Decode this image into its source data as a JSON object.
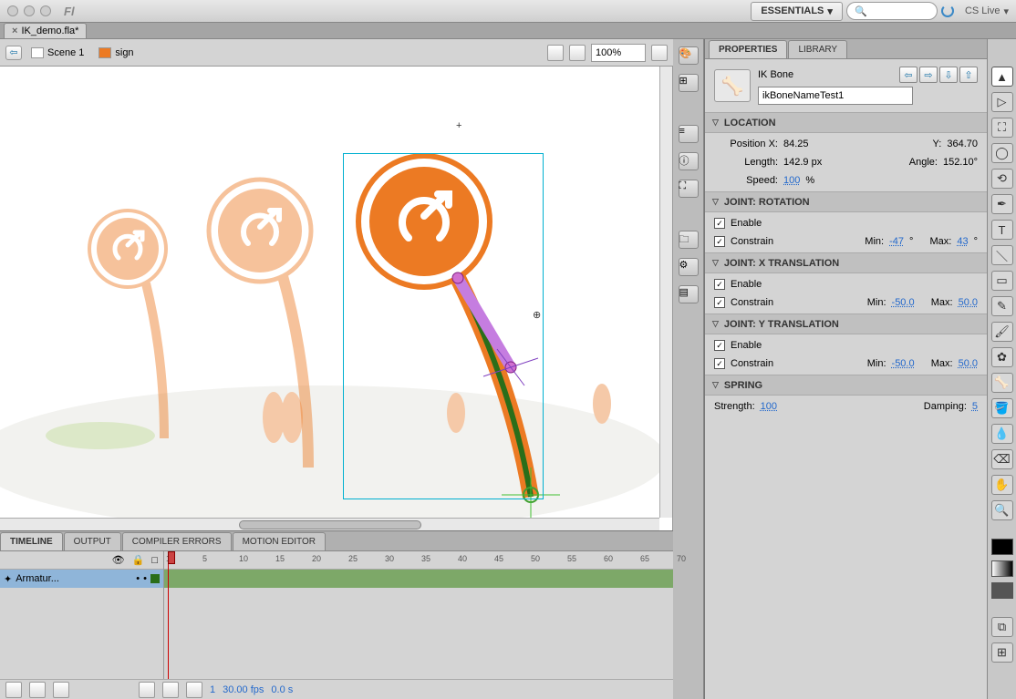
{
  "titlebar": {
    "workspace": "ESSENTIALS",
    "cslive": "CS Live"
  },
  "doc": {
    "tab": "IK_demo.fla*",
    "scene": "Scene 1",
    "symbol": "sign",
    "zoom": "100%"
  },
  "properties": {
    "tab_properties": "PROPERTIES",
    "tab_library": "LIBRARY",
    "type": "IK Bone",
    "name": "ikBoneNameTest1",
    "location": {
      "title": "LOCATION",
      "posx_label": "Position X:",
      "posx": "84.25",
      "y_label": "Y:",
      "y": "364.70",
      "len_label": "Length:",
      "len": "142.9 px",
      "angle_label": "Angle:",
      "angle": "152.10°",
      "speed_label": "Speed:",
      "speed": "100",
      "speed_suffix": "%"
    },
    "rotation": {
      "title": "JOINT: ROTATION",
      "enable": "Enable",
      "constrain": "Constrain",
      "min_label": "Min:",
      "min": "-47",
      "min_suffix": "°",
      "max_label": "Max:",
      "max": "43",
      "max_suffix": "°"
    },
    "xtrans": {
      "title": "JOINT: X TRANSLATION",
      "enable": "Enable",
      "constrain": "Constrain",
      "min_label": "Min:",
      "min": "-50.0",
      "max_label": "Max:",
      "max": "50.0"
    },
    "ytrans": {
      "title": "JOINT: Y TRANSLATION",
      "enable": "Enable",
      "constrain": "Constrain",
      "min_label": "Min:",
      "min": "-50.0",
      "max_label": "Max:",
      "max": "50.0"
    },
    "spring": {
      "title": "SPRING",
      "strength_label": "Strength:",
      "strength": "100",
      "damping_label": "Damping:",
      "damping": "5"
    }
  },
  "timeline": {
    "tabs": {
      "timeline": "TIMELINE",
      "output": "OUTPUT",
      "errors": "COMPILER ERRORS",
      "motion": "MOTION EDITOR"
    },
    "layer": "Armatur...",
    "ticks": [
      "1",
      "5",
      "10",
      "15",
      "20",
      "25",
      "30",
      "35",
      "40",
      "45",
      "50",
      "55",
      "60",
      "65",
      "70"
    ],
    "fps": "30.00 fps",
    "time": "0.0 s",
    "frame": "1"
  }
}
